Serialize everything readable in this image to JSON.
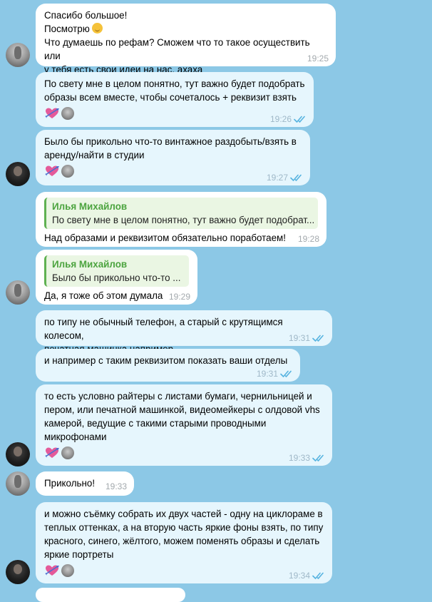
{
  "messages": [
    {
      "id": "m1",
      "lines": [
        "Спасибо большое!",
        "Посмотрю",
        "Что думаешь по рефам? Сможем что то такое осуществить или",
        "у тебя есть свои идеи на нас, ахаха"
      ],
      "time": "19:25",
      "emoji": "relieved-face"
    },
    {
      "id": "m2",
      "lines": [
        "По свету мне в целом понятно, тут важно будет подобрать",
        "образы всем вместе, чтобы сочеталось + реквизит взять"
      ],
      "time": "19:26"
    },
    {
      "id": "m3",
      "lines": [
        "Было бы прикольно что-то винтажное раздобыть/взять в",
        "аренду/найти в студии"
      ],
      "time": "19:27"
    },
    {
      "id": "m4",
      "quote_name": "Илья Михайлов",
      "quote_text": "По свету мне в целом понятно, тут важно будет подобрат...",
      "text": "Над образами и реквизитом обязательно поработаем!",
      "time": "19:28"
    },
    {
      "id": "m5",
      "quote_name": "Илья Михайлов",
      "quote_text": "Было бы прикольно что-то ...",
      "text": "Да, я тоже об этом думала",
      "time": "19:29"
    },
    {
      "id": "m6",
      "lines": [
        "по типу не обычный телефон, а старый с крутящимся колесом,",
        "печатная машинка например"
      ],
      "time": "19:31"
    },
    {
      "id": "m7",
      "lines": [
        "и например с таким реквизитом показать ваши отделы"
      ],
      "time": "19:31"
    },
    {
      "id": "m8",
      "lines": [
        "то есть условно райтеры с листами бумаги, чернильницей и",
        "пером, или печатной машинкой, видеомейкеры с олдовой vhs",
        "камерой, ведущие с такими старыми проводными",
        "микрофонами"
      ],
      "time": "19:33"
    },
    {
      "id": "m9",
      "lines": [
        "Прикольно!"
      ],
      "time": "19:33"
    },
    {
      "id": "m10",
      "lines": [
        "и можно съёмку собрать их двух частей - одну на циклораме в",
        "теплых оттенках, а на вторую часть яркие фоны взять, по типу",
        "красного, синего, жёлтого, можем поменять образы и сделать",
        "яркие портреты"
      ],
      "time": "19:34"
    }
  ],
  "icons": {
    "read_receipt": "double-check-icon",
    "reaction": "heart-arrow-icon"
  },
  "colors": {
    "background": "#8cc8e6",
    "incoming": "#ffffff",
    "outgoing": "#e6f6fd",
    "quote_accent": "#4ca43f",
    "check": "#56b3e0"
  }
}
